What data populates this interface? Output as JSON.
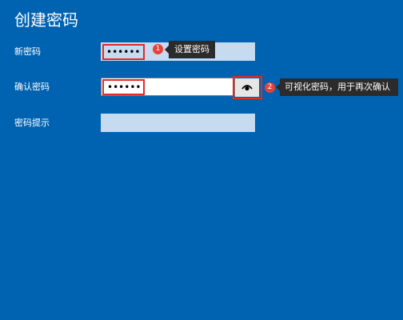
{
  "page": {
    "title": "创建密码"
  },
  "fields": {
    "password": {
      "label": "新密码",
      "value": "••••••"
    },
    "confirm": {
      "label": "确认密码",
      "value": "••••••"
    },
    "hint": {
      "label": "密码提示",
      "value": ""
    }
  },
  "reveal_button": {
    "icon": "eye-icon"
  },
  "annotations": [
    {
      "number": "1",
      "text": "设置密码"
    },
    {
      "number": "2",
      "text": "可视化密码，用于再次确认"
    }
  ],
  "colors": {
    "background": "#0063b1",
    "highlight": "#e02b28",
    "badge": "#e8413a",
    "tooltip": "#2b2b2b"
  }
}
